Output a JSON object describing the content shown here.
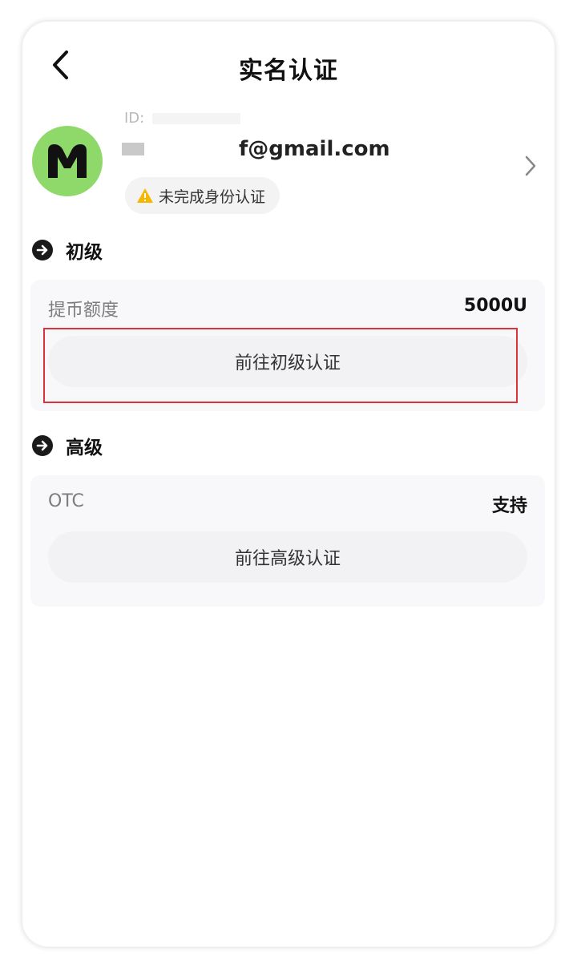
{
  "header": {
    "title": "实名认证",
    "back_icon": "chevron-left-icon"
  },
  "profile": {
    "avatar_letter": "M",
    "avatar_color": "#8fd96a",
    "id_label": "ID:",
    "email": "f@gmail.com",
    "status_badge": "未完成身份认证",
    "status_icon": "warning-icon",
    "status_icon_color": "#f5b800"
  },
  "sections": [
    {
      "title": "初级",
      "row_label": "提币额度",
      "row_value": "5000U",
      "button_label": "前往初级认证"
    },
    {
      "title": "高级",
      "row_label": "OTC",
      "row_value": "支持",
      "button_label": "前往高级认证"
    }
  ],
  "colors": {
    "highlight": "#d9343a",
    "card_bg": "#f8f8fa"
  }
}
